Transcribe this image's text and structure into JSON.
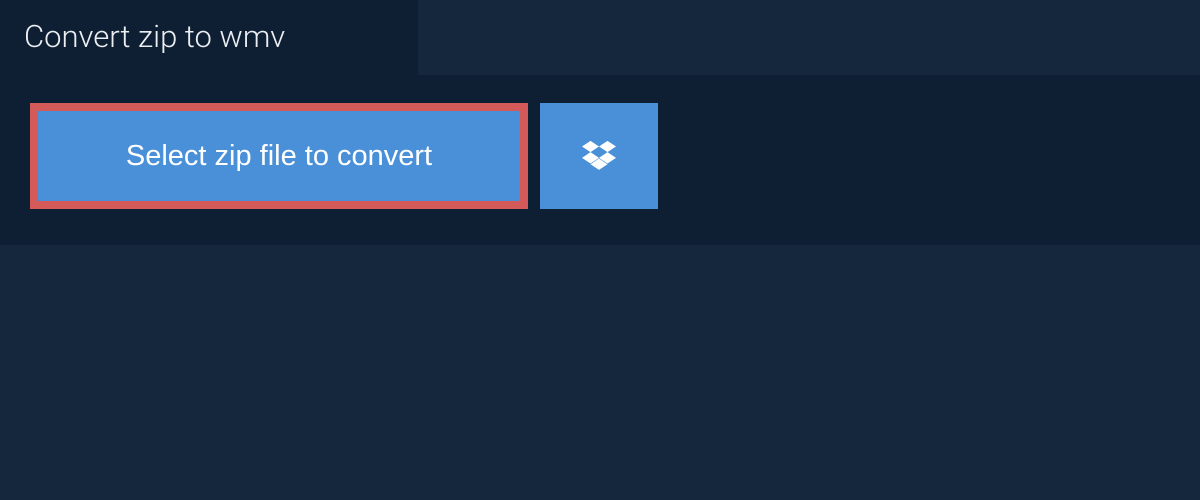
{
  "header": {
    "title": "Convert zip to wmv"
  },
  "main": {
    "select_button_label": "Select zip file to convert"
  },
  "colors": {
    "background": "#15273d",
    "panel": "#0e1f34",
    "button": "#4990d8",
    "highlight_border": "#d45959",
    "text_light": "#eceff2"
  }
}
